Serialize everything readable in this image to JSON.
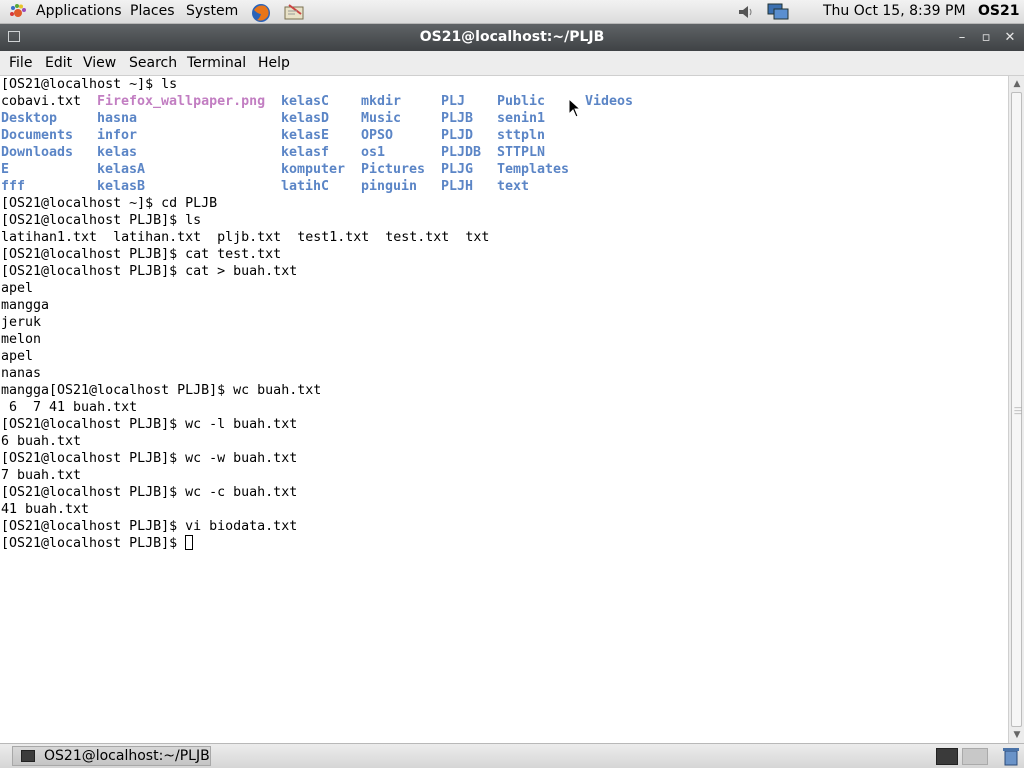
{
  "top_panel": {
    "applications": "Applications",
    "places": "Places",
    "system": "System",
    "clock": "Thu Oct 15,  8:39 PM",
    "user": "OS21"
  },
  "window": {
    "title": "OS21@localhost:~/PLJB"
  },
  "menubar": {
    "items": [
      "File",
      "Edit",
      "View",
      "Search",
      "Terminal",
      "Help"
    ]
  },
  "terminal": {
    "ls_prompt": "[OS21@localhost ~]$ ls",
    "ls_columns": [
      [
        {
          "t": "cobavi.txt",
          "c": "file"
        },
        {
          "t": "Desktop",
          "c": "dir"
        },
        {
          "t": "Documents",
          "c": "dir"
        },
        {
          "t": "Downloads",
          "c": "dir"
        },
        {
          "t": "E",
          "c": "dir"
        },
        {
          "t": "fff",
          "c": "dir"
        }
      ],
      [
        {
          "t": "Firefox_wallpaper.png",
          "c": "img"
        },
        {
          "t": "hasna",
          "c": "dir"
        },
        {
          "t": "infor",
          "c": "dir"
        },
        {
          "t": "kelas",
          "c": "dir"
        },
        {
          "t": "kelasA",
          "c": "dir"
        },
        {
          "t": "kelasB",
          "c": "dir"
        }
      ],
      [
        {
          "t": "kelasC",
          "c": "dir"
        },
        {
          "t": "kelasD",
          "c": "dir"
        },
        {
          "t": "kelasE",
          "c": "dir"
        },
        {
          "t": "kelasf",
          "c": "dir"
        },
        {
          "t": "komputer",
          "c": "dir"
        },
        {
          "t": "latihC",
          "c": "dir"
        }
      ],
      [
        {
          "t": "mkdir",
          "c": "dir"
        },
        {
          "t": "Music",
          "c": "dir"
        },
        {
          "t": "OPSO",
          "c": "dir"
        },
        {
          "t": "os1",
          "c": "dir"
        },
        {
          "t": "Pictures",
          "c": "dir"
        },
        {
          "t": "pinguin",
          "c": "dir"
        }
      ],
      [
        {
          "t": "PLJ",
          "c": "dir"
        },
        {
          "t": "PLJB",
          "c": "dir"
        },
        {
          "t": "PLJD",
          "c": "dir"
        },
        {
          "t": "PLJDB",
          "c": "dir"
        },
        {
          "t": "PLJG",
          "c": "dir"
        },
        {
          "t": "PLJH",
          "c": "dir"
        }
      ],
      [
        {
          "t": "Public",
          "c": "dir"
        },
        {
          "t": "senin1",
          "c": "dir"
        },
        {
          "t": "sttpln",
          "c": "dir"
        },
        {
          "t": "STTPLN",
          "c": "dir"
        },
        {
          "t": "Templates",
          "c": "dir"
        },
        {
          "t": "text",
          "c": "dir"
        }
      ],
      [
        {
          "t": "Videos",
          "c": "dir"
        }
      ]
    ],
    "lines": [
      "[OS21@localhost ~]$ cd PLJB",
      "[OS21@localhost PLJB]$ ls",
      "latihan1.txt  latihan.txt  pljb.txt  test1.txt  test.txt  txt",
      "[OS21@localhost PLJB]$ cat test.txt",
      "[OS21@localhost PLJB]$ cat > buah.txt",
      "apel",
      "mangga",
      "jeruk",
      "melon",
      "apel",
      "nanas",
      "mangga[OS21@localhost PLJB]$ wc buah.txt",
      " 6  7 41 buah.txt",
      "[OS21@localhost PLJB]$ wc -l buah.txt",
      "6 buah.txt",
      "[OS21@localhost PLJB]$ wc -w buah.txt",
      "7 buah.txt",
      "[OS21@localhost PLJB]$ wc -c buah.txt",
      "41 buah.txt",
      "[OS21@localhost PLJB]$ vi biodata.txt"
    ],
    "current_prompt": "[OS21@localhost PLJB]$ "
  },
  "taskbar": {
    "window_button": "OS21@localhost:~/PLJB"
  },
  "colors": {
    "directory": "#5b85c6",
    "image_file": "#c27ec2",
    "titlebar": "#4a4d50"
  }
}
